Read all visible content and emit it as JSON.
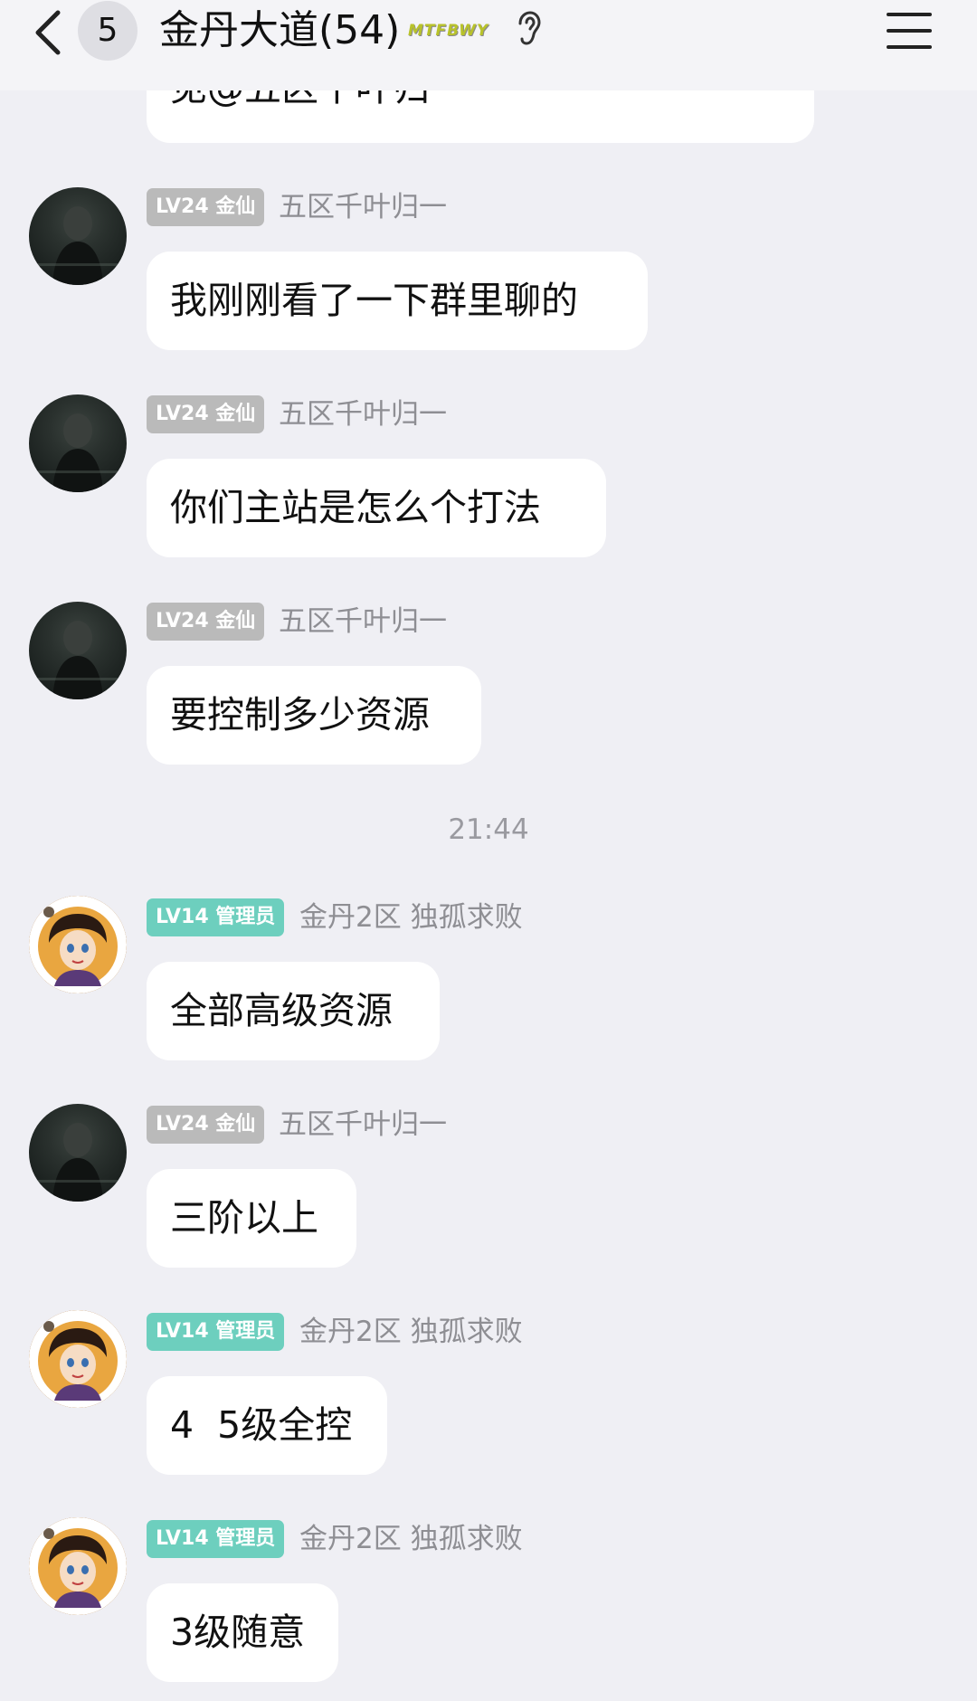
{
  "header": {
    "unread_count": "5",
    "group_title": "金丹大道(54)",
    "brand_tag": "MTFBWY",
    "icons": {
      "back": "chevron-left-icon",
      "ear": "ear-icon",
      "menu": "hamburger-menu-icon"
    }
  },
  "messages": [
    {
      "sender": "",
      "badge": "",
      "text": "见@五区千叶归一",
      "partial": true
    },
    {
      "badge": "LV24 金仙",
      "badge_color": "#bababa",
      "sender": "五区千叶归一",
      "text": "我刚刚看了一下群里聊的"
    },
    {
      "badge": "LV24 金仙",
      "badge_color": "#bababa",
      "sender": "五区千叶归一",
      "text": "你们主站是怎么个打法"
    },
    {
      "badge": "LV24 金仙",
      "badge_color": "#bababa",
      "sender": "五区千叶归一",
      "text": "要控制多少资源"
    },
    {
      "badge": "LV14 管理员",
      "badge_color": "#6dcfbe",
      "sender": "金丹2区 独孤求败",
      "text": "全部高级资源"
    },
    {
      "badge": "LV24 金仙",
      "badge_color": "#bababa",
      "sender": "五区千叶归一",
      "text": "三阶以上"
    },
    {
      "badge": "LV14 管理员",
      "badge_color": "#6dcfbe",
      "sender": "金丹2区 独孤求败",
      "text": "4  5级全控"
    },
    {
      "badge": "LV14 管理员",
      "badge_color": "#6dcfbe",
      "sender": "金丹2区 独孤求败",
      "text": "3级随意"
    }
  ],
  "timestamp": "21:44"
}
